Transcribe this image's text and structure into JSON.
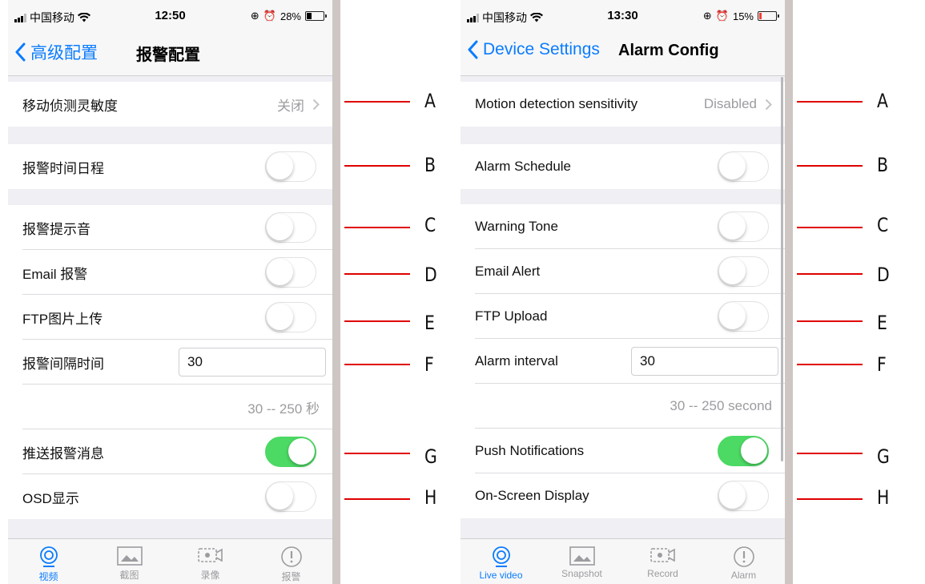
{
  "left": {
    "status": {
      "carrier": "中国移动",
      "time": "12:50",
      "battery": "28%",
      "battery_level": 0.28
    },
    "nav": {
      "back_label": "高级配置",
      "title": "报警配置"
    },
    "rows": {
      "motion_label": "移动侦测灵敏度",
      "motion_value": "关闭",
      "schedule_label": "报警时间日程",
      "tone_label": "报警提示音",
      "email_label": "Email 报警",
      "ftp_label": "FTP图片上传",
      "interval_label": "报警间隔时间",
      "interval_value": "30",
      "range_text": "30 -- 250 秒",
      "push_label": "推送报警消息",
      "osd_label": "OSD显示"
    },
    "toggles": {
      "schedule": false,
      "tone": false,
      "email": false,
      "ftp": false,
      "push": true,
      "osd": false
    },
    "tabs": [
      "视频",
      "截图",
      "录像",
      "报警"
    ]
  },
  "right": {
    "status": {
      "carrier": "中国移动",
      "time": "13:30",
      "battery": "15%",
      "battery_level": 0.15
    },
    "nav": {
      "back_label": "Device Settings",
      "title": "Alarm Config"
    },
    "rows": {
      "motion_label": "Motion detection sensitivity",
      "motion_value": "Disabled",
      "schedule_label": "Alarm Schedule",
      "tone_label": "Warning Tone",
      "email_label": "Email Alert",
      "ftp_label": "FTP Upload",
      "interval_label": "Alarm interval",
      "interval_value": "30",
      "range_text": "30 -- 250 second",
      "push_label": "Push Notifications",
      "osd_label": "On-Screen Display"
    },
    "toggles": {
      "schedule": false,
      "tone": false,
      "email": false,
      "ftp": false,
      "push": true,
      "osd": false
    },
    "tabs": [
      "Live video",
      "Snapshot",
      "Record",
      "Alarm"
    ]
  },
  "annotations": [
    "A",
    "B",
    "C",
    "D",
    "E",
    "F",
    "G",
    "H"
  ],
  "colors": {
    "accent": "#0a7cff",
    "toggle_on": "#4cd964",
    "annotation_line": "#e00000",
    "battery_low": "#ff3b30"
  }
}
